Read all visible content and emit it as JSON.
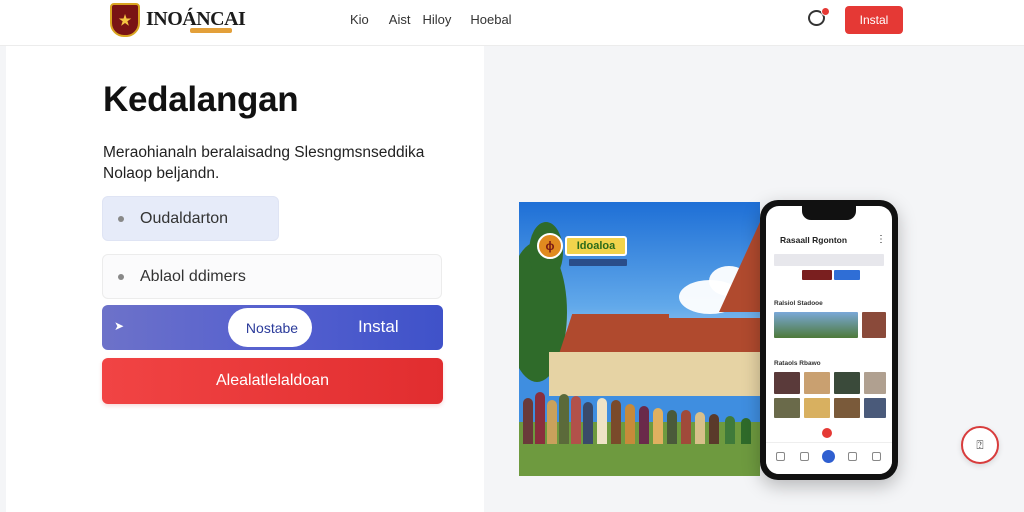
{
  "header": {
    "logo_text": "INOÁNCAI",
    "logo_icon": "crest-icon",
    "nav": [
      "Kio",
      "Aist",
      "Hiloy",
      "Hoebal"
    ],
    "notification_icon": "chat-bubble-icon",
    "install_label": "Instal"
  },
  "main": {
    "title": "Kedalangan",
    "description": "Meraohianaln beralaisadng Slesngmsnseddika Nolaop beljandn.",
    "options": [
      "Oudaldarton",
      "Ablaol ddimers"
    ],
    "install_bar": {
      "tab_label": "Nostabe",
      "label": "Instal",
      "more_icon": "more-vertical-icon"
    },
    "red_button_label": "Alealatlelaldoan"
  },
  "photo": {
    "badge_text": "ɸ",
    "tag_text": "Idoaloa"
  },
  "phone": {
    "title": "Rasaall Rgonton",
    "section_labels": [
      "Ralsiol Stadooe",
      "Rataols Rbawo"
    ]
  },
  "help_button_icon": "help-icon",
  "colors": {
    "accent_red": "#e53935",
    "accent_blue": "#3f52c9",
    "option_bg": "#e6ebf9"
  }
}
